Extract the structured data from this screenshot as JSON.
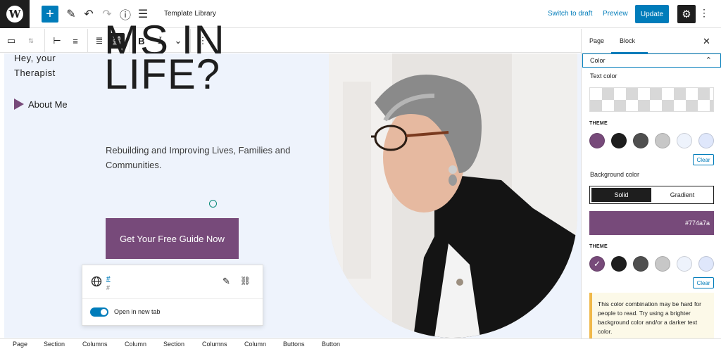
{
  "topbar": {
    "document_title": "Template Library",
    "switch_to_draft": "Switch to draft",
    "preview": "Preview",
    "update": "Update"
  },
  "canvas": {
    "greeting_line1": "Hey, your",
    "greeting_line2": "Therapist",
    "about_me": "About Me",
    "headline_line1": "MS IN",
    "headline_line2": "LIFE?",
    "subtext": "Rebuilding and Improving Lives, Families and Communities.",
    "cta": "Get Your Free Guide Now"
  },
  "link_popover": {
    "link_title": "#",
    "link_url": "#",
    "toggle_label": "Open in new tab",
    "toggle_on": true
  },
  "sidebar": {
    "tabs": [
      "Page",
      "Block"
    ],
    "active_tab": "Block",
    "section_title": "Color",
    "text_color_label": "Text color",
    "theme_label": "THEME",
    "clear_label": "Clear",
    "background_color_label": "Background color",
    "segment_solid": "Solid",
    "segment_gradient": "Gradient",
    "background_value": "#774a7a",
    "theme_colors": [
      "#774a7a",
      "#1e1e1e",
      "#4f4f4f",
      "#c7c7c7",
      "#eef3fc",
      "#dfe7fb"
    ],
    "selected_background_index": 0,
    "warning": "This color combination may be hard for people to read. Try using a brighter background color and/or a darker text color."
  },
  "breadcrumb": [
    "Page",
    "Section",
    "Columns",
    "Column",
    "Section",
    "Columns",
    "Column",
    "Buttons",
    "Button"
  ],
  "colors": {
    "accent": "#007cba",
    "brand_purple": "#774a7a",
    "canvas_bg": "#eef3fc"
  }
}
